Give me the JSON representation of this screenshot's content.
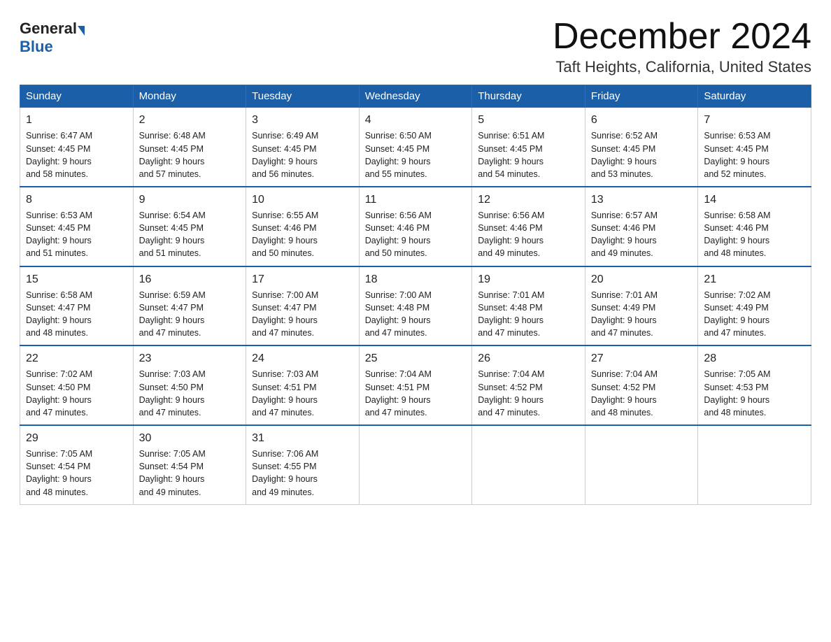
{
  "header": {
    "logo_general": "General",
    "logo_blue": "Blue",
    "month_title": "December 2024",
    "location": "Taft Heights, California, United States"
  },
  "weekdays": [
    "Sunday",
    "Monday",
    "Tuesday",
    "Wednesday",
    "Thursday",
    "Friday",
    "Saturday"
  ],
  "weeks": [
    [
      {
        "day": "1",
        "sunrise": "6:47 AM",
        "sunset": "4:45 PM",
        "daylight": "9 hours and 58 minutes."
      },
      {
        "day": "2",
        "sunrise": "6:48 AM",
        "sunset": "4:45 PM",
        "daylight": "9 hours and 57 minutes."
      },
      {
        "day": "3",
        "sunrise": "6:49 AM",
        "sunset": "4:45 PM",
        "daylight": "9 hours and 56 minutes."
      },
      {
        "day": "4",
        "sunrise": "6:50 AM",
        "sunset": "4:45 PM",
        "daylight": "9 hours and 55 minutes."
      },
      {
        "day": "5",
        "sunrise": "6:51 AM",
        "sunset": "4:45 PM",
        "daylight": "9 hours and 54 minutes."
      },
      {
        "day": "6",
        "sunrise": "6:52 AM",
        "sunset": "4:45 PM",
        "daylight": "9 hours and 53 minutes."
      },
      {
        "day": "7",
        "sunrise": "6:53 AM",
        "sunset": "4:45 PM",
        "daylight": "9 hours and 52 minutes."
      }
    ],
    [
      {
        "day": "8",
        "sunrise": "6:53 AM",
        "sunset": "4:45 PM",
        "daylight": "9 hours and 51 minutes."
      },
      {
        "day": "9",
        "sunrise": "6:54 AM",
        "sunset": "4:45 PM",
        "daylight": "9 hours and 51 minutes."
      },
      {
        "day": "10",
        "sunrise": "6:55 AM",
        "sunset": "4:46 PM",
        "daylight": "9 hours and 50 minutes."
      },
      {
        "day": "11",
        "sunrise": "6:56 AM",
        "sunset": "4:46 PM",
        "daylight": "9 hours and 50 minutes."
      },
      {
        "day": "12",
        "sunrise": "6:56 AM",
        "sunset": "4:46 PM",
        "daylight": "9 hours and 49 minutes."
      },
      {
        "day": "13",
        "sunrise": "6:57 AM",
        "sunset": "4:46 PM",
        "daylight": "9 hours and 49 minutes."
      },
      {
        "day": "14",
        "sunrise": "6:58 AM",
        "sunset": "4:46 PM",
        "daylight": "9 hours and 48 minutes."
      }
    ],
    [
      {
        "day": "15",
        "sunrise": "6:58 AM",
        "sunset": "4:47 PM",
        "daylight": "9 hours and 48 minutes."
      },
      {
        "day": "16",
        "sunrise": "6:59 AM",
        "sunset": "4:47 PM",
        "daylight": "9 hours and 47 minutes."
      },
      {
        "day": "17",
        "sunrise": "7:00 AM",
        "sunset": "4:47 PM",
        "daylight": "9 hours and 47 minutes."
      },
      {
        "day": "18",
        "sunrise": "7:00 AM",
        "sunset": "4:48 PM",
        "daylight": "9 hours and 47 minutes."
      },
      {
        "day": "19",
        "sunrise": "7:01 AM",
        "sunset": "4:48 PM",
        "daylight": "9 hours and 47 minutes."
      },
      {
        "day": "20",
        "sunrise": "7:01 AM",
        "sunset": "4:49 PM",
        "daylight": "9 hours and 47 minutes."
      },
      {
        "day": "21",
        "sunrise": "7:02 AM",
        "sunset": "4:49 PM",
        "daylight": "9 hours and 47 minutes."
      }
    ],
    [
      {
        "day": "22",
        "sunrise": "7:02 AM",
        "sunset": "4:50 PM",
        "daylight": "9 hours and 47 minutes."
      },
      {
        "day": "23",
        "sunrise": "7:03 AM",
        "sunset": "4:50 PM",
        "daylight": "9 hours and 47 minutes."
      },
      {
        "day": "24",
        "sunrise": "7:03 AM",
        "sunset": "4:51 PM",
        "daylight": "9 hours and 47 minutes."
      },
      {
        "day": "25",
        "sunrise": "7:04 AM",
        "sunset": "4:51 PM",
        "daylight": "9 hours and 47 minutes."
      },
      {
        "day": "26",
        "sunrise": "7:04 AM",
        "sunset": "4:52 PM",
        "daylight": "9 hours and 47 minutes."
      },
      {
        "day": "27",
        "sunrise": "7:04 AM",
        "sunset": "4:52 PM",
        "daylight": "9 hours and 48 minutes."
      },
      {
        "day": "28",
        "sunrise": "7:05 AM",
        "sunset": "4:53 PM",
        "daylight": "9 hours and 48 minutes."
      }
    ],
    [
      {
        "day": "29",
        "sunrise": "7:05 AM",
        "sunset": "4:54 PM",
        "daylight": "9 hours and 48 minutes."
      },
      {
        "day": "30",
        "sunrise": "7:05 AM",
        "sunset": "4:54 PM",
        "daylight": "9 hours and 49 minutes."
      },
      {
        "day": "31",
        "sunrise": "7:06 AM",
        "sunset": "4:55 PM",
        "daylight": "9 hours and 49 minutes."
      },
      null,
      null,
      null,
      null
    ]
  ]
}
